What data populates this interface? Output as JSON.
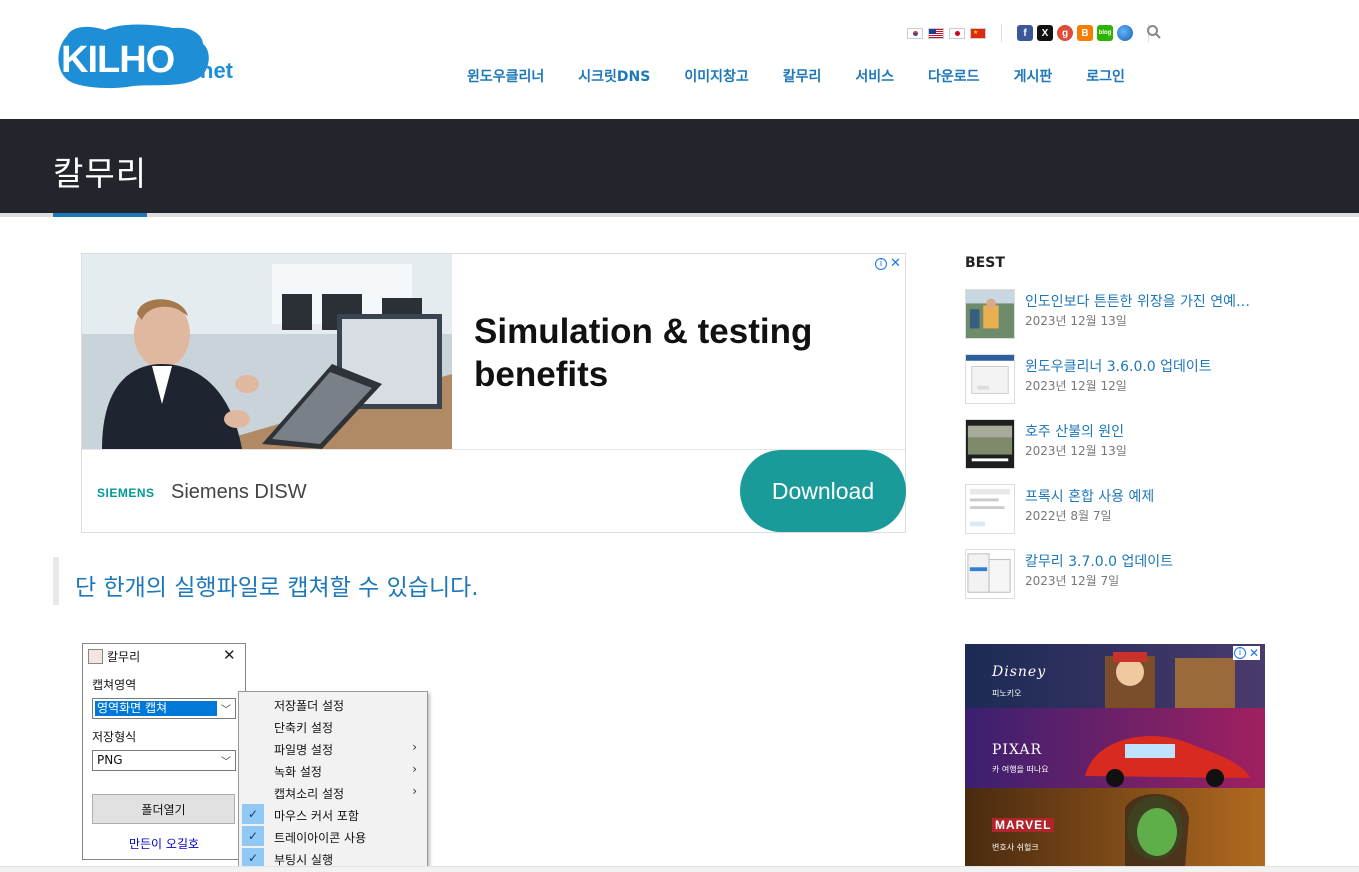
{
  "header": {
    "logo_text": "KILHO.net",
    "languages": [
      "ko",
      "en",
      "ja",
      "zh"
    ],
    "social": [
      {
        "name": "facebook",
        "color": "#3b5998",
        "glyph": "f"
      },
      {
        "name": "x",
        "color": "#111111",
        "glyph": "X"
      },
      {
        "name": "google-plus",
        "color": "#dd4b39",
        "glyph": "g"
      },
      {
        "name": "blogger",
        "color": "#f57d00",
        "glyph": "B"
      },
      {
        "name": "naver-blog",
        "color": "#2db400",
        "glyph": "blog"
      },
      {
        "name": "globe",
        "color": "#2b7bd1",
        "glyph": "●"
      }
    ],
    "nav": [
      "윈도우클리너",
      "시크릿DNS",
      "이미지창고",
      "칼무리",
      "서비스",
      "다운로드",
      "게시판",
      "로그인"
    ]
  },
  "page": {
    "title": "칼무리"
  },
  "ad_top": {
    "headline": "Simulation & testing benefits",
    "brand": "SIEMENS",
    "advertiser": "Siemens DISW",
    "cta": "Download",
    "accent_color": "#1a9b9a"
  },
  "content": {
    "quote": "단 한개의 실행파일로 캡쳐할 수 있습니다."
  },
  "app_window": {
    "title": "칼무리",
    "capture_label": "캡쳐영역",
    "capture_value": "영역화면 캡쳐",
    "format_label": "저장형식",
    "format_value": "PNG",
    "open_folder": "폴더열기",
    "author_link": "만든이 오길호"
  },
  "context_menu": {
    "items": [
      {
        "label": "저장폴더 설정",
        "checked": false,
        "submenu": false
      },
      {
        "label": "단축키 설정",
        "checked": false,
        "submenu": false
      },
      {
        "label": "파일명 설정",
        "checked": false,
        "submenu": true
      },
      {
        "label": "녹화 설정",
        "checked": false,
        "submenu": true
      },
      {
        "label": "캡쳐소리 설정",
        "checked": false,
        "submenu": true
      },
      {
        "label": "마우스 커서 포함",
        "checked": true,
        "submenu": false
      },
      {
        "label": "트레이아이콘 사용",
        "checked": true,
        "submenu": false
      },
      {
        "label": "부팅시 실행",
        "checked": true,
        "submenu": false
      }
    ]
  },
  "sidebar": {
    "best_title": "BEST",
    "items": [
      {
        "title": "인도인보다 튼튼한 위장을 가진 연예…",
        "date": "2023년 12월 13일"
      },
      {
        "title": "윈도우클리너 3.6.0.0 업데이트",
        "date": "2023년 12월 12일"
      },
      {
        "title": "호주 산불의 원인",
        "date": "2023년 12월 13일"
      },
      {
        "title": "프록시 혼합 사용 예제",
        "date": "2022년 8월 7일"
      },
      {
        "title": "칼무리 3.7.0.0 업데이트",
        "date": "2023년 12월 7일"
      }
    ]
  },
  "ad_side": {
    "bands": [
      {
        "brand": "Disney",
        "sub": "피노키오"
      },
      {
        "brand": "PIXAR",
        "sub": "카 여행을 떠나요"
      },
      {
        "brand": "MARVEL",
        "sub": "변호사 쉬헐크"
      }
    ]
  },
  "colors": {
    "link": "#1d77b8",
    "title_bar": "#22262c"
  }
}
